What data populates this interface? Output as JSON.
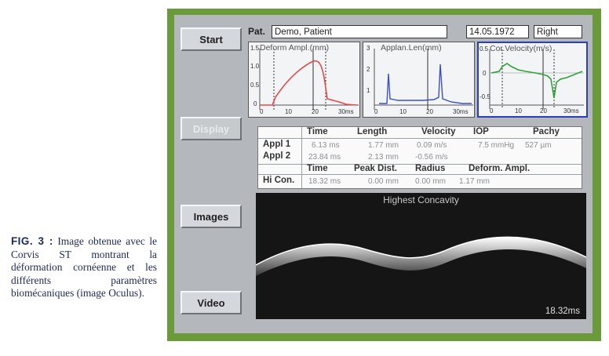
{
  "caption": {
    "label": "FIG. 3 :",
    "text": "Image obtenue avec le Corvis ST montrant la déformation cornéenne et les différents paramètres biomécaniques (image Oculus)."
  },
  "sidebar": {
    "start": "Start",
    "display": "Display",
    "images": "Images",
    "video": "Video"
  },
  "patient": {
    "label": "Pat.",
    "name": "Demo, Patient",
    "date": "14.05.1972",
    "eye": "Right"
  },
  "graphs": [
    {
      "title": "Deform Ampl.(mm)",
      "color": "#e34b4b",
      "yticks": [
        "1.5",
        "1.0",
        "0.5",
        "0"
      ],
      "xticks": [
        "0",
        "10",
        "20",
        "30ms"
      ]
    },
    {
      "title": "Applan.Len(mm)",
      "color": "#3a4fc8",
      "yticks": [
        "3",
        "2",
        "1"
      ],
      "xticks": [
        "0",
        "10",
        "20",
        "30ms"
      ]
    },
    {
      "title": "Cor.Velocity(m/s)",
      "color": "#2fa33a",
      "yticks": [
        "0.5",
        "0",
        "-0.5"
      ],
      "xticks": [
        "0",
        "10",
        "20",
        "30ms"
      ]
    }
  ],
  "table": {
    "headers1": [
      "Time",
      "Length",
      "Velocity",
      "IOP",
      "Pachy"
    ],
    "appl1": {
      "label": "Appl 1",
      "time": "6.13 ms",
      "length": "1.77 mm",
      "velocity": "0.09 m/s",
      "iop": "7.5 mmHg",
      "pachy": "527 µm"
    },
    "appl2": {
      "label": "Appl 2",
      "time": "23.84 ms",
      "length": "2.13 mm",
      "velocity": "-0.56 m/s"
    },
    "headers2": [
      "Time",
      "Peak Dist.",
      "Radius",
      "Deform. Ampl."
    ],
    "hicon": {
      "label": "Hi Con.",
      "time": "18.32 ms",
      "peak": "0.00 mm",
      "radius": "0.00 mm",
      "deform": "1.17 mm"
    }
  },
  "scan": {
    "title": "Highest Concavity",
    "time": "18.32ms"
  }
}
